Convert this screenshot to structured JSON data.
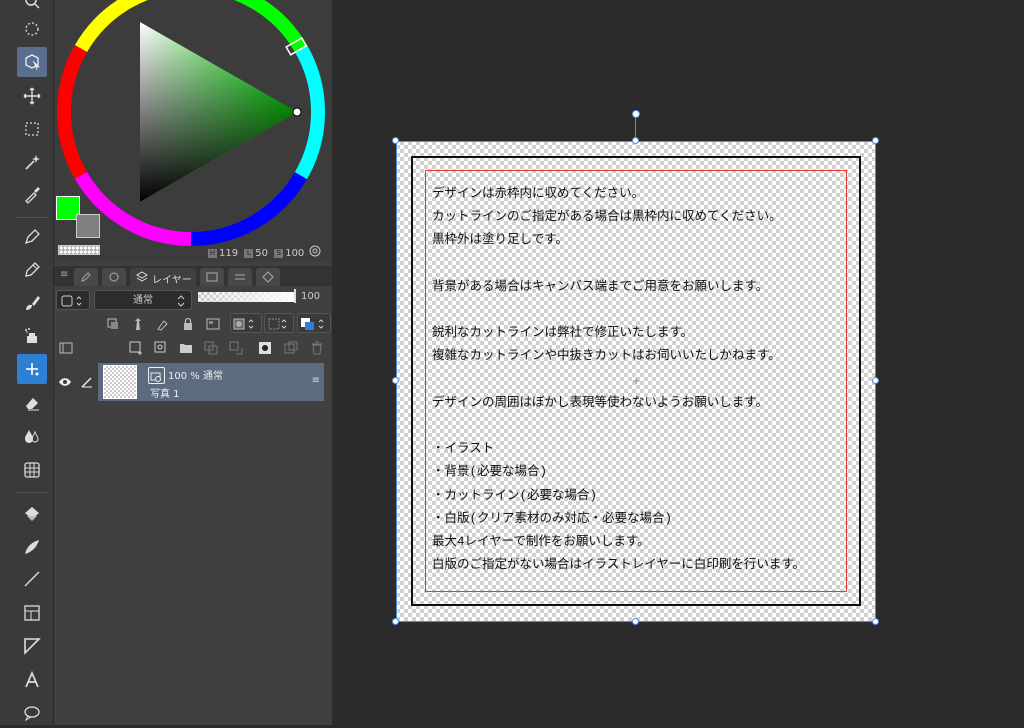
{
  "color_panel": {
    "readout_h_tag": "H",
    "readout_h": "119",
    "readout_l_tag": "L",
    "readout_l": "50",
    "readout_s_tag": "S",
    "readout_s": "100",
    "main_color": "#00ff00",
    "sub_color": "#808080"
  },
  "layer_panel": {
    "tab_label": "レイヤー",
    "blend_mode": "通常",
    "opacity_value": "100",
    "opacity_fraction": 1.0,
    "layer": {
      "opacity": "100 %",
      "mode": "通常",
      "name": "写真 1"
    }
  },
  "canvas": {
    "guide_text": "デザインは赤枠内に収めてください。\nカットラインのご指定がある場合は黒枠内に収めてください。\n黒枠外は塗り足しです。\n\n背景がある場合はキャンバス端までご用意をお願いします。\n\n鋭利なカットラインは弊社で修正いたします。\n複雑なカットラインや中抜きカットはお伺いいたしかねます。\n\nデザインの周囲はぼかし表現等使わないようお願いします。\n\n・イラスト\n・背景(必要な場合)\n・カットライン(必要な場合)\n・白版(クリア素材のみ対応・必要な場合)\n最大4レイヤーで制作をお願いします。\n白版のご指定がない場合はイラストレイヤーに白印刷を行います。",
    "center_mark": "+",
    "bleed_frame_color": "#111111",
    "safe_frame_color": "#e63b3b",
    "selection_color": "#4d8fe0"
  },
  "tools": [
    "search-icon",
    "lasso-icon",
    "object-select-icon",
    "move-icon",
    "marquee-icon",
    "magic-wand-icon",
    "eyedropper-icon",
    "pen-icon",
    "pencil-icon",
    "brush-icon",
    "airbrush-icon",
    "decoration-icon",
    "eraser-icon",
    "blend-icon",
    "figure-ruler-icon",
    "fill-icon",
    "gradient-icon",
    "line-icon",
    "frame-icon",
    "direct-draw-icon",
    "text-icon",
    "balloon-icon"
  ]
}
